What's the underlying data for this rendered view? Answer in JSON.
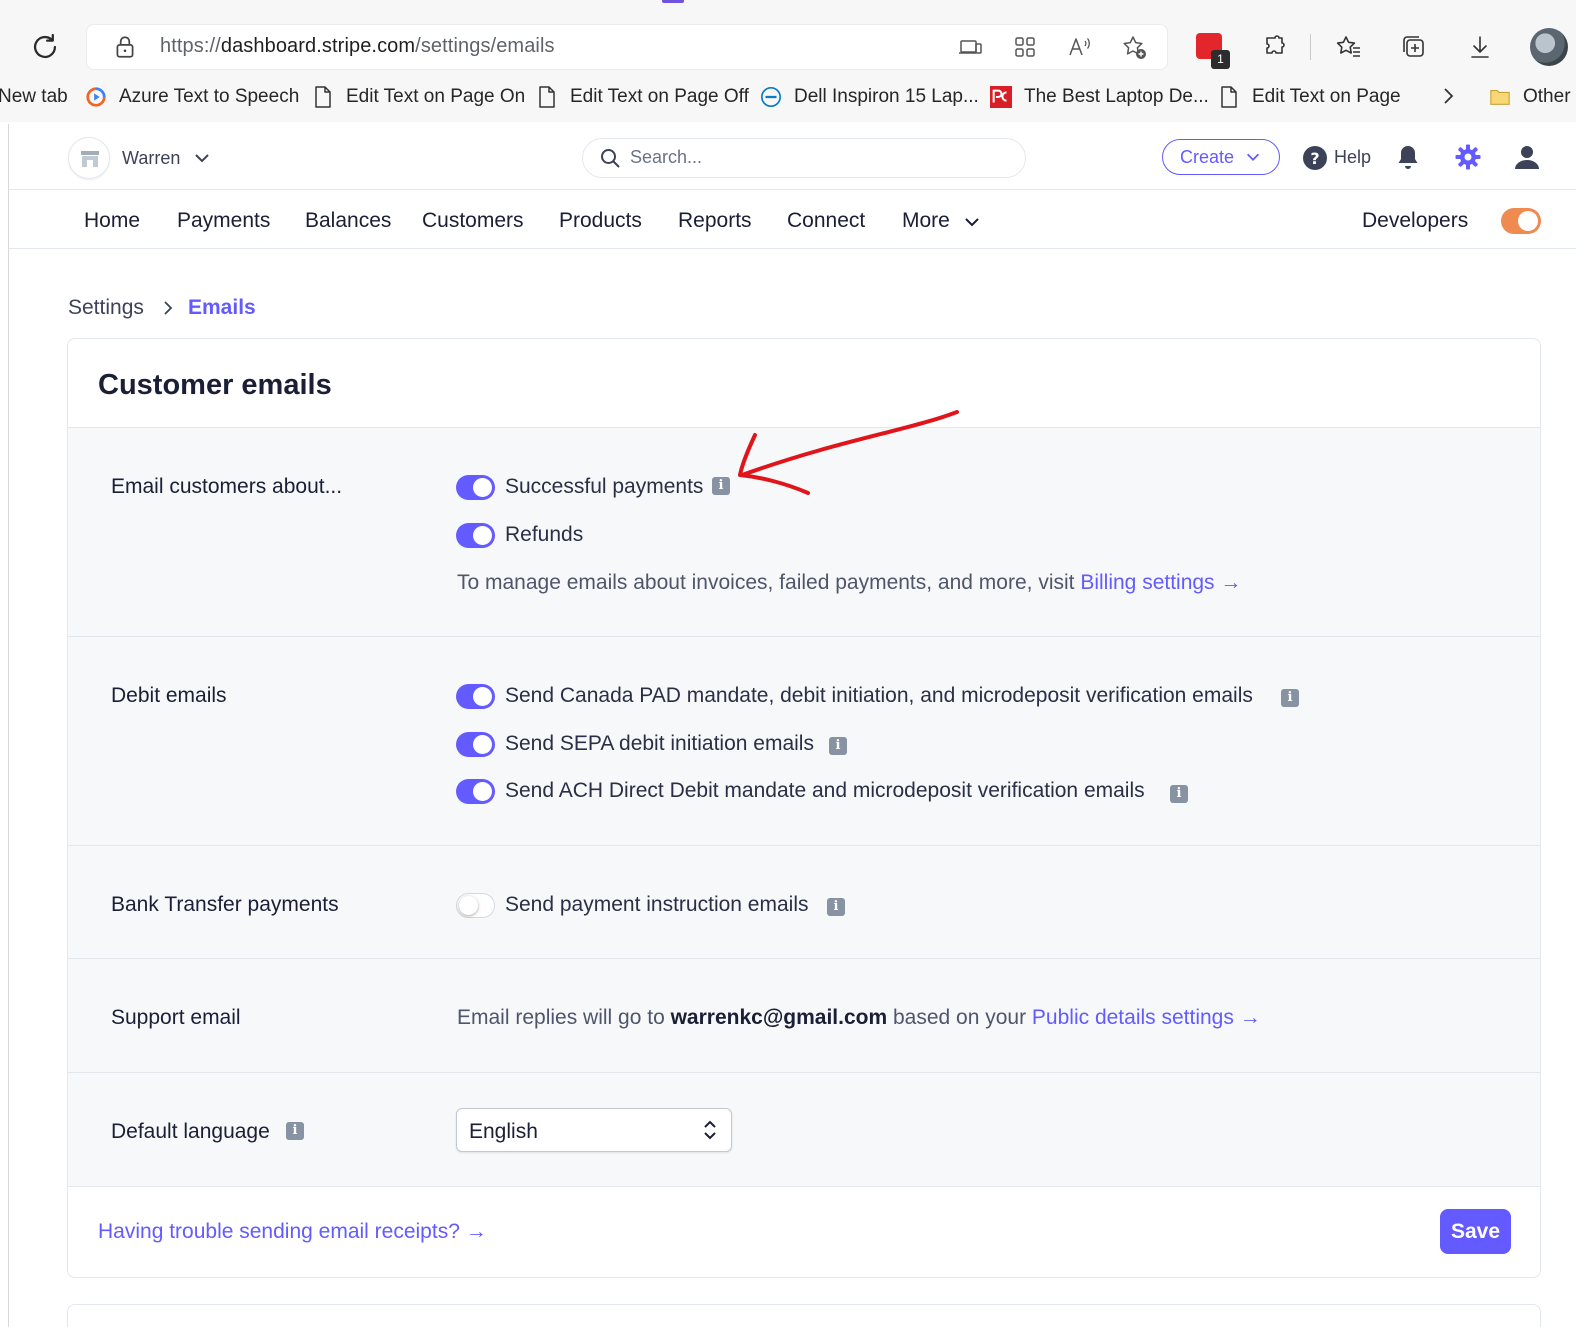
{
  "browser": {
    "url_prefix": "https://",
    "url_host": "dashboard.stripe.com",
    "url_path": "/settings/emails",
    "extension_badge": "1",
    "bookmarks": [
      {
        "label": "New tab"
      },
      {
        "label": "Azure Text to Speech"
      },
      {
        "label": "Edit Text on Page On"
      },
      {
        "label": "Edit Text on Page Off"
      },
      {
        "label": "Dell Inspiron 15 Lap..."
      },
      {
        "label": "The Best Laptop De..."
      },
      {
        "label": "Edit Text on Page"
      },
      {
        "label": "Other"
      }
    ]
  },
  "header": {
    "account_name": "Warren",
    "search_placeholder": "Search...",
    "create_label": "Create",
    "help_label": "Help"
  },
  "nav": {
    "items": [
      "Home",
      "Payments",
      "Balances",
      "Customers",
      "Products",
      "Reports",
      "Connect",
      "More"
    ],
    "developers_label": "Developers",
    "developers_toggle_on": true
  },
  "breadcrumb": {
    "parent": "Settings",
    "current": "Emails"
  },
  "card": {
    "title": "Customer emails",
    "sections": {
      "email_customers": {
        "label": "Email customers about...",
        "options": [
          {
            "label": "Successful payments",
            "enabled": true
          },
          {
            "label": "Refunds",
            "enabled": true
          }
        ],
        "note": "To manage emails about invoices, failed payments, and more, visit ",
        "note_link": "Billing settings"
      },
      "debit_emails": {
        "label": "Debit emails",
        "options": [
          {
            "label": "Send Canada PAD mandate, debit initiation, and microdeposit verification emails",
            "enabled": true
          },
          {
            "label": "Send SEPA debit initiation emails",
            "enabled": true
          },
          {
            "label": "Send ACH Direct Debit mandate and microdeposit verification emails",
            "enabled": true
          }
        ]
      },
      "bank_transfer": {
        "label": "Bank Transfer payments",
        "options": [
          {
            "label": "Send payment instruction emails",
            "enabled": false
          }
        ]
      },
      "support_email": {
        "label": "Support email",
        "prefix": "Email replies will go to ",
        "email": "warrenkc@gmail.com",
        "middle": " based on your ",
        "link": "Public details settings"
      },
      "default_language": {
        "label": "Default language",
        "value": "English"
      }
    },
    "trouble_link": "Having trouble sending email receipts?",
    "save_label": "Save"
  },
  "colors": {
    "accent": "#635bff",
    "toggle_dev": "#ef8a50",
    "annotation": "#e0151b",
    "section_bg": "#f6f8fa"
  }
}
